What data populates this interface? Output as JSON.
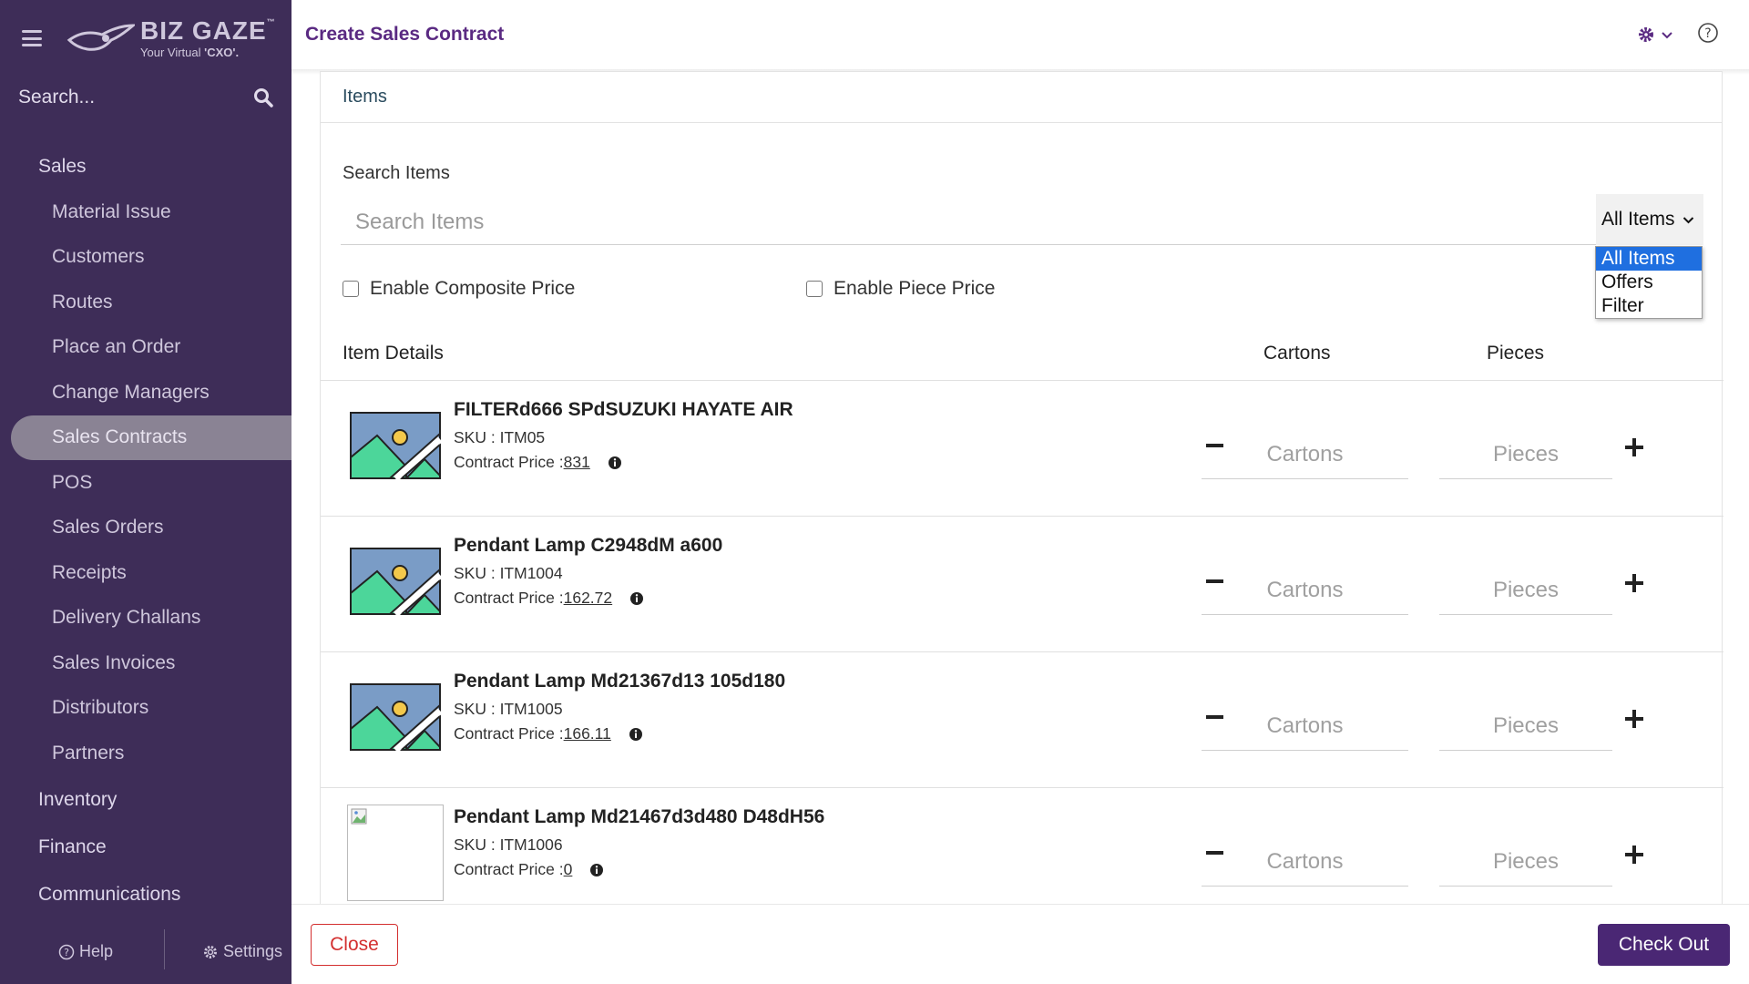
{
  "sidebar": {
    "brand": {
      "name": "BIZ GAZE",
      "tm": "™",
      "tagline_prefix": "Your Virtual ",
      "tagline_bold": "'CXO'."
    },
    "search": {
      "placeholder": "Search..."
    },
    "sections": [
      {
        "label": "Sales"
      },
      {
        "label": "Inventory"
      },
      {
        "label": "Finance"
      },
      {
        "label": "Communications"
      }
    ],
    "items": [
      {
        "label": "Material Issue"
      },
      {
        "label": "Customers"
      },
      {
        "label": "Routes"
      },
      {
        "label": "Place an Order"
      },
      {
        "label": "Change Managers"
      },
      {
        "label": "Sales Contracts",
        "active": true
      },
      {
        "label": "POS"
      },
      {
        "label": "Sales Orders"
      },
      {
        "label": "Receipts"
      },
      {
        "label": "Delivery Challans"
      },
      {
        "label": "Sales Invoices"
      },
      {
        "label": "Distributors"
      },
      {
        "label": "Partners"
      }
    ],
    "footer": {
      "help": "Help",
      "settings": "Settings"
    }
  },
  "header": {
    "title": "Create Sales Contract",
    "settings_icon": "gear-icon",
    "help_icon": "question-circle-icon"
  },
  "panel": {
    "title": "Items",
    "search_label": "Search Items",
    "search_placeholder": "Search Items",
    "filter_selected": "All Items",
    "filter_options": [
      "All Items",
      "Offers",
      "Filter"
    ],
    "composite_label": "Enable Composite Price",
    "piece_label": "Enable Piece Price",
    "columns": {
      "details": "Item Details",
      "cartons": "Cartons",
      "pieces": "Pieces"
    },
    "cartons_placeholder": "Cartons",
    "pieces_placeholder": "Pieces",
    "items": [
      {
        "name": "FILTERd666 SPdSUZUKI HAYATE AIR",
        "sku": "SKU : ITM05",
        "price_label": "Contract Price :",
        "price": "831",
        "image": "placeholder"
      },
      {
        "name": "Pendant Lamp C2948dM a600",
        "sku": "SKU : ITM1004",
        "price_label": "Contract Price :",
        "price": "162.72",
        "image": "placeholder"
      },
      {
        "name": "Pendant Lamp Md21367d13 105d180",
        "sku": "SKU : ITM1005",
        "price_label": "Contract Price :",
        "price": "166.11",
        "image": "placeholder"
      },
      {
        "name": "Pendant Lamp Md21467d3d480 D48dH56",
        "sku": "SKU : ITM1006",
        "price_label": "Contract Price :",
        "price": "0",
        "image": "broken"
      }
    ]
  },
  "footer": {
    "close": "Close",
    "checkout": "Check Out"
  },
  "colors": {
    "sidebar_bg": "#3e2d58",
    "title": "#5a2a82",
    "checkout_bg": "#4a2774",
    "close": "#d32f2f",
    "dropdown_selected": "#1f6fe0"
  }
}
